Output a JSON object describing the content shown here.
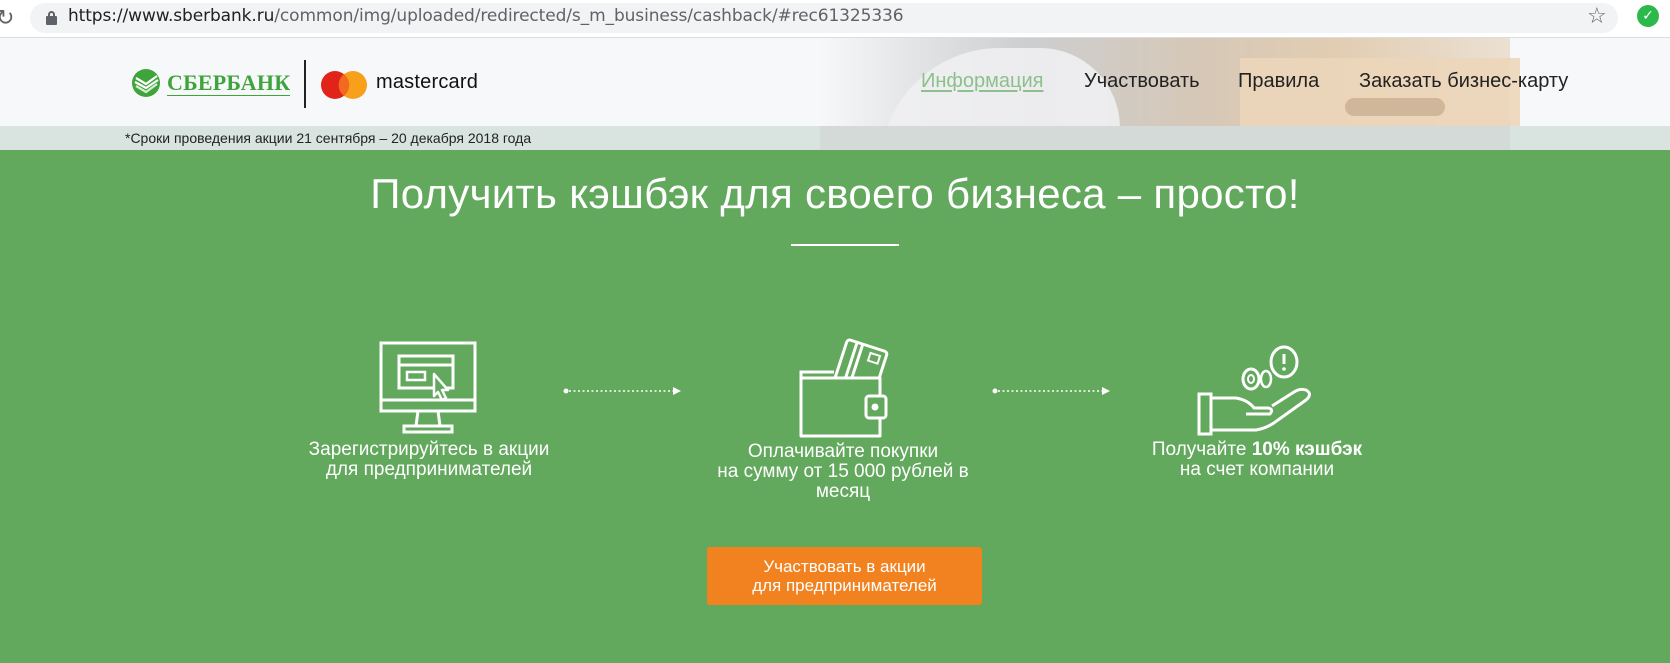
{
  "browser": {
    "url_host": "https://www.sberbank.ru",
    "url_path": "/common/img/uploaded/redirected/s_m_business/cashback/#rec61325336"
  },
  "header": {
    "brand_sber": "СБЕРБАНК",
    "brand_mc": "mastercard",
    "nav": {
      "info": "Информация",
      "participate": "Участвовать",
      "rules": "Правила",
      "order_card": "Заказать бизнес-карту"
    },
    "promo_note": "*Сроки проведения акции 21 сентября – 20 декабря 2018 года"
  },
  "main": {
    "headline": "Получить кэшбэк для своего бизнеса – просто!",
    "steps": [
      {
        "line1": "Зарегистрируйтесь в акции",
        "line2": "для предпринимателей",
        "icon": "computer-monitor-icon"
      },
      {
        "line1": "Оплачивайте покупки",
        "line2": "на сумму от 15 000 рублей в",
        "line3": "месяц",
        "icon": "wallet-cards-icon"
      },
      {
        "line1_prefix": "Получайте ",
        "line1_bold": "10% кэшбэк",
        "line2": "на счет компании",
        "icon": "hand-coins-icon"
      }
    ],
    "cta": {
      "line1": "Участвовать в акции",
      "line2": "для предпринимателей"
    }
  },
  "colors": {
    "green_bg": "#62a85d",
    "sber_green": "#3fa43c",
    "cta_orange": "#f28220",
    "nav_active": "#8cc08c"
  }
}
